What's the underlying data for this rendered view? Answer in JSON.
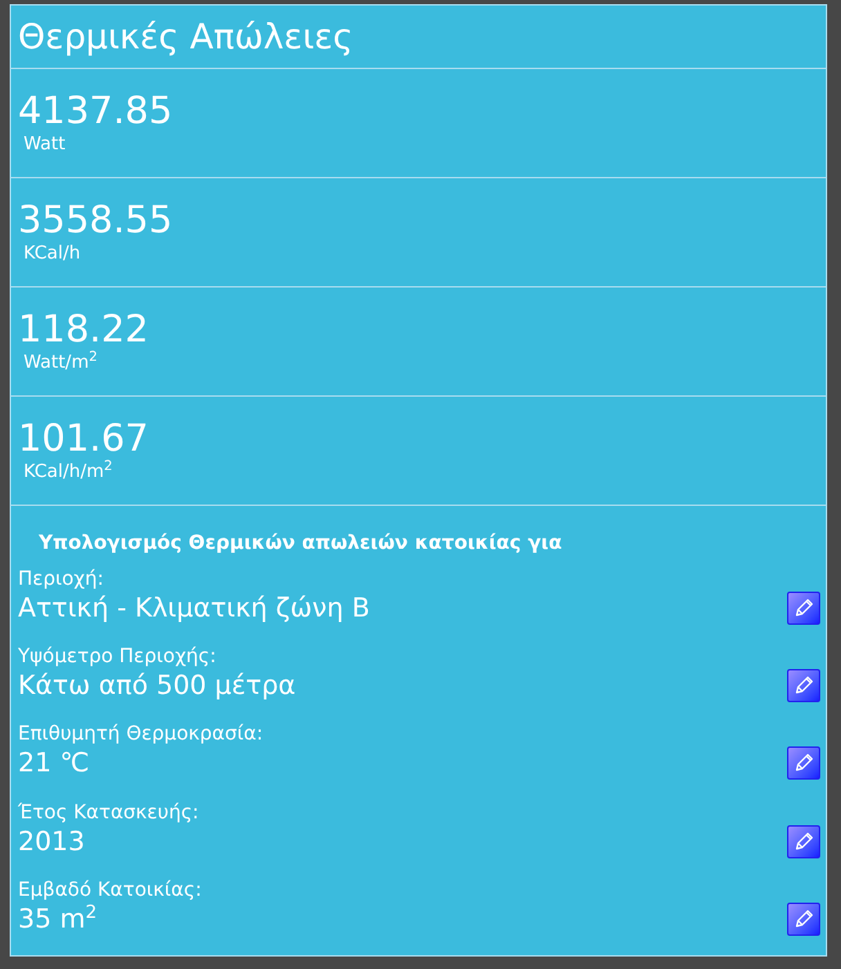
{
  "title": "Θερμικές Απώλειες",
  "results": [
    {
      "value": "4137.85",
      "unit": "Watt"
    },
    {
      "value": "3558.55",
      "unit": "KCal/h"
    },
    {
      "value": "118.22",
      "unit": "Watt/m$^{2}$"
    },
    {
      "value": "101.67",
      "unit": "KCal/h/m$^{2}$"
    }
  ],
  "inputs_heading": "Υπολογισμός Θερμικών απωλειών κατοικίας για",
  "inputs": [
    {
      "label": "Περιοχή:",
      "value": "Αττική - Κλιματική ζώνη Β"
    },
    {
      "label": "Υψόμετρο Περιοχής:",
      "value": "Κάτω από 500 μέτρα"
    },
    {
      "label": "Επιθυμητή Θερμοκρασία:",
      "value": "21 ℃"
    },
    {
      "label": "Έτος Κατασκευής:",
      "value": "2013"
    },
    {
      "label": "Εμβαδό Κατοικίας:",
      "value": "35 m$^{2}$"
    }
  ]
}
